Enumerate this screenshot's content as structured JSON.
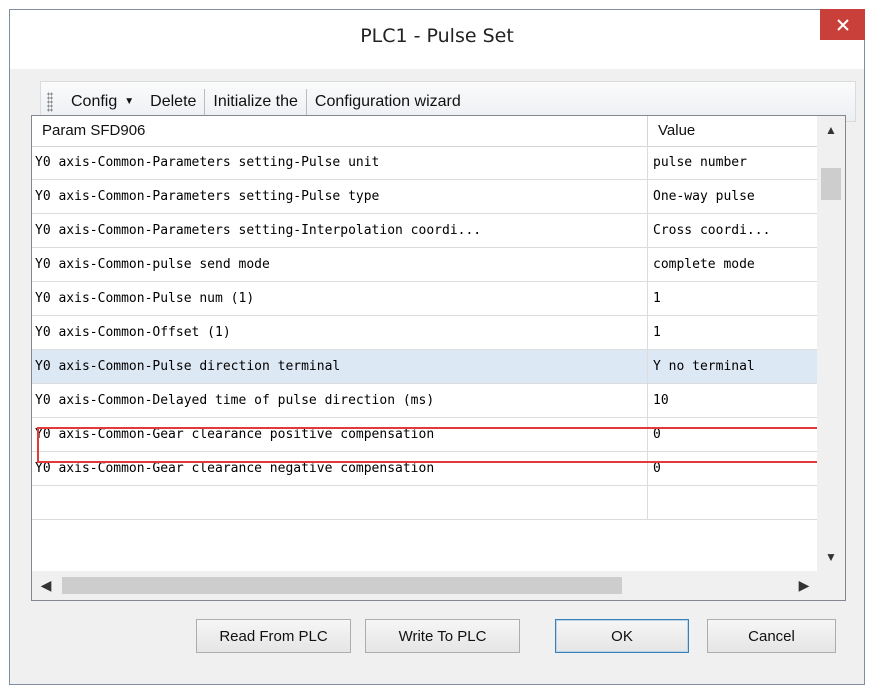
{
  "window": {
    "title": "PLC1 - Pulse  Set"
  },
  "toolbar": {
    "config": "Config",
    "delete": "Delete",
    "initialize": "Initialize the",
    "wizard": "Configuration wizard"
  },
  "grid": {
    "col_param": "Param SFD906",
    "col_value": "Value",
    "rows": [
      {
        "param": "Y0 axis-Common-Parameters setting-Pulse unit",
        "value": "pulse number"
      },
      {
        "param": "Y0 axis-Common-Parameters setting-Pulse type",
        "value": "One-way pulse"
      },
      {
        "param": "Y0 axis-Common-Parameters setting-Interpolation coordi...",
        "value": "Cross coordi..."
      },
      {
        "param": "Y0 axis-Common-pulse send mode",
        "value": "complete mode"
      },
      {
        "param": "Y0 axis-Common-Pulse num (1)",
        "value": "1"
      },
      {
        "param": "Y0 axis-Common-Offset (1)",
        "value": "1"
      },
      {
        "param": "Y0 axis-Common-Pulse direction terminal",
        "value": "Y no terminal"
      },
      {
        "param": "Y0 axis-Common-Delayed time of pulse direction (ms)",
        "value": "10"
      },
      {
        "param": "Y0 axis-Common-Gear clearance positive compensation",
        "value": "0"
      },
      {
        "param": "Y0 axis-Common-Gear clearance negative compensation",
        "value": "0"
      }
    ]
  },
  "buttons": {
    "read": "Read From PLC",
    "write": "Write To PLC",
    "ok": "OK",
    "cancel": "Cancel"
  },
  "colors": {
    "close": "#c9403a",
    "highlight": "#e23a3a",
    "selected_row": "#dde8f5"
  }
}
